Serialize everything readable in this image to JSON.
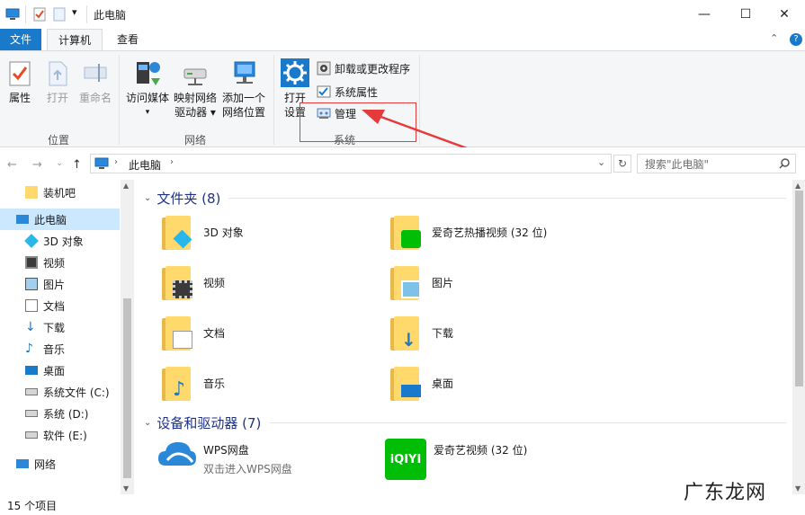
{
  "titlebar": {
    "title": "此电脑",
    "minimize_symbol": "—",
    "maximize_symbol": "☐",
    "close_symbol": "✕",
    "dropdown_symbol": "▾"
  },
  "tabs": {
    "file": "文件",
    "computer": "计算机",
    "view": "查看",
    "expand_symbol": "⌃",
    "help_symbol": "?"
  },
  "ribbon": {
    "location_group": {
      "label": "位置",
      "properties": "属性",
      "open": "打开",
      "rename": "重命名"
    },
    "network_group": {
      "label": "网络",
      "access_media_line1": "访问媒体",
      "access_media_arrow": "▾",
      "map_drive_line1": "映射网络",
      "map_drive_line2": "驱动器 ▾",
      "add_location_line1": "添加一个",
      "add_location_line2": "网络位置"
    },
    "system_group": {
      "label": "系统",
      "open_settings_line1": "打开",
      "open_settings_line2": "设置",
      "uninstall": "卸载或更改程序",
      "system_properties": "系统属性",
      "manage": "管理"
    }
  },
  "addressbar": {
    "back": "←",
    "forward": "→",
    "recent": "⌄",
    "up": "↑",
    "path": "此电脑",
    "path_sep": "›",
    "dropdown": "⌄",
    "refresh": "↻",
    "search_placeholder": "搜索\"此电脑\"",
    "search_icon": "🔍"
  },
  "navpane": {
    "items": [
      {
        "label": "装机吧",
        "icon": "folder-icon"
      },
      {
        "label": "此电脑",
        "icon": "computer-icon"
      },
      {
        "label": "3D 对象",
        "icon": "3d-objects-icon"
      },
      {
        "label": "视频",
        "icon": "video-icon"
      },
      {
        "label": "图片",
        "icon": "pictures-icon"
      },
      {
        "label": "文档",
        "icon": "documents-icon"
      },
      {
        "label": "下载",
        "icon": "download-icon"
      },
      {
        "label": "音乐",
        "icon": "music-icon"
      },
      {
        "label": "桌面",
        "icon": "desktop-icon"
      },
      {
        "label": "系统文件 (C:)",
        "icon": "drive-icon"
      },
      {
        "label": "系统 (D:)",
        "icon": "drive-icon"
      },
      {
        "label": "软件 (E:)",
        "icon": "drive-icon"
      },
      {
        "label": "网络",
        "icon": "network-icon"
      }
    ]
  },
  "content": {
    "folders_section": "文件夹 (8)",
    "devices_section": "设备和驱动器 (7)",
    "folders": [
      {
        "label": "3D 对象",
        "icon": "3d-objects-icon"
      },
      {
        "label": "爱奇艺热播视频 (32 位)",
        "icon": "iqiyi-icon"
      },
      {
        "label": "视频",
        "icon": "video-icon"
      },
      {
        "label": "图片",
        "icon": "pictures-icon"
      },
      {
        "label": "文档",
        "icon": "documents-icon"
      },
      {
        "label": "下载",
        "icon": "download-icon"
      },
      {
        "label": "音乐",
        "icon": "music-icon"
      },
      {
        "label": "桌面",
        "icon": "desktop-icon"
      }
    ],
    "devices": [
      {
        "label": "WPS网盘",
        "sublabel": "双击进入WPS网盘",
        "icon": "wps-cloud-icon"
      },
      {
        "label": "爱奇艺视频 (32 位)",
        "icon": "iqiyi-icon"
      }
    ],
    "iqiyi_text": "iQIYI"
  },
  "statusbar": {
    "count": "15 个项目"
  },
  "watermark": "广东龙网",
  "colors": {
    "accent": "#1979ca",
    "highlight_box": "#e53b3b",
    "selection": "#cce8ff",
    "section_title": "#1e3287",
    "folder": "#ffd96b",
    "iqiyi_green": "#00be06"
  }
}
